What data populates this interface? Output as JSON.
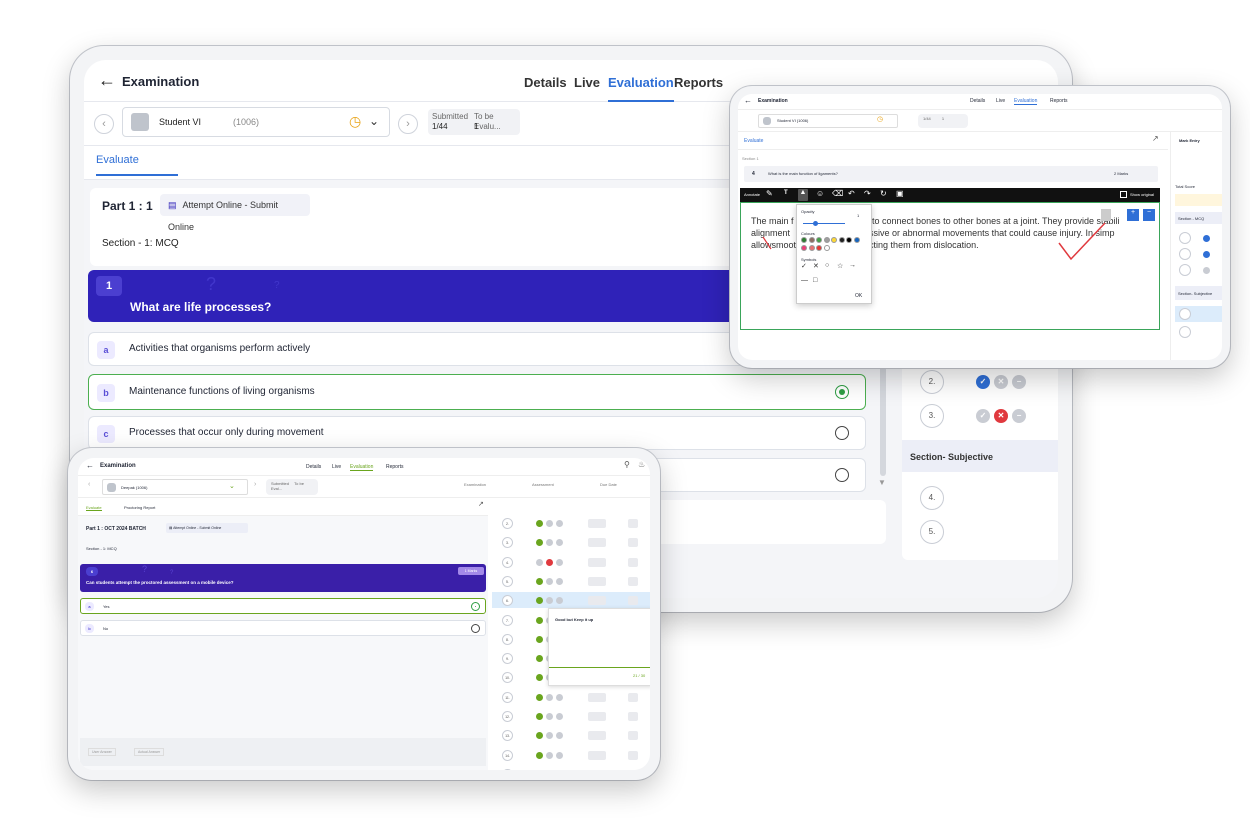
{
  "main": {
    "title": "Examination",
    "tabs": [
      "Details",
      "Live",
      "Evaluation",
      "Reports"
    ],
    "active_tab": "Evaluation",
    "student_name": "Student VI",
    "student_id": "(1006)",
    "submitted_label": "Submitted",
    "submitted_value": "1/44",
    "to_be_evaluated_label": "To be Evalu...",
    "to_be_evaluated_value": "1",
    "evaluate_tab": "Evaluate",
    "part_title": "Part 1 : 1",
    "attempt_mode": "Attempt Online - Submit Online",
    "section_title": "Section - 1: MCQ",
    "question_number": "1",
    "question_text": "What are life processes?",
    "options": [
      {
        "letter": "a",
        "text": "Activities that organisms perform actively",
        "selected": false,
        "show_radio": false
      },
      {
        "letter": "b",
        "text": "Maintenance functions of living organisms",
        "selected": true,
        "show_radio": true
      },
      {
        "letter": "c",
        "text": "Processes that occur only during movement",
        "selected": false,
        "show_radio": true
      },
      {
        "letter": "",
        "text": "",
        "selected": false,
        "show_radio": true
      }
    ],
    "right_panel": {
      "rows": [
        "2.",
        "3."
      ],
      "subjective_title": "Section- Subjective",
      "subjective_rows": [
        "4.",
        "5."
      ]
    }
  },
  "annotator": {
    "title": "Examination",
    "tabs": [
      "Details",
      "Live",
      "Evaluation",
      "Reports"
    ],
    "student_name": "Student VI (1006)",
    "submitted": "1/44",
    "to_be_evaluated": "1",
    "evaluate_tab": "Evaluate",
    "section_label": "Section 1",
    "question_number": "4",
    "question_text": "What is the main function of ligaments?",
    "marks": "2 Marks",
    "toolbar_label": "Annotate",
    "show_original": "Show original",
    "answer_lines": [
      "The main f                        ts is to connect bones to other bones at a joint. They provide stabili",
      "alignment                    nt excessive or abnormal movements that could cause injury. In simp",
      "allowsmooth                   protecting them from dislocation."
    ],
    "popup": {
      "opacity_label": "Opacity",
      "opacity_value": "1",
      "colours_label": "Colours",
      "symbols_label": "Symbols",
      "ok_label": "OK"
    },
    "side": {
      "mark_entry": "Mark Entry",
      "total_score": "Total Score",
      "section_mcq": "Section - MCQ",
      "section_subjective": "Section- Subjective"
    }
  },
  "proctor": {
    "title": "Examination",
    "tabs": [
      "Details",
      "Live",
      "Evaluation",
      "Reports"
    ],
    "student_name": "Deepak (1006)",
    "submitted": "Submitted",
    "to_be_evaluated": "To be Eval...",
    "examination_label": "Examination",
    "assessment_label": "Assessment",
    "due_date_label": "Due Date",
    "tab_evaluate": "Evaluate",
    "tab_report": "Proctoring Report",
    "part_title": "Part 1 : OCT 2024 BATCH",
    "attempt_mode": "Attempt Online - Submit Online",
    "section_title": "Section - 1: MCQ",
    "question_number": "6",
    "marks": "1 Marks",
    "question_text": "Can students attempt the proctored assessment on a mobile device?",
    "options": [
      {
        "letter": "a",
        "text": "Yes",
        "selected": true
      },
      {
        "letter": "b",
        "text": "No",
        "selected": false
      }
    ],
    "user_answer": "User Answer",
    "actual_answer": "Actual Answer",
    "popup_text": "Good but Keep it up",
    "popup_score": "21 / 30",
    "row_numbers": [
      "2.",
      "3.",
      "4.",
      "5.",
      "6.",
      "7.",
      "8.",
      "9.",
      "10.",
      "11.",
      "12.",
      "13.",
      "14.",
      "15."
    ]
  },
  "colors": {
    "accent": "#2f6fd6",
    "question_banner": "#2f22b8",
    "correct": "#2e9e44",
    "wrong": "#e0393e",
    "proctor_green": "#6aa51e"
  }
}
